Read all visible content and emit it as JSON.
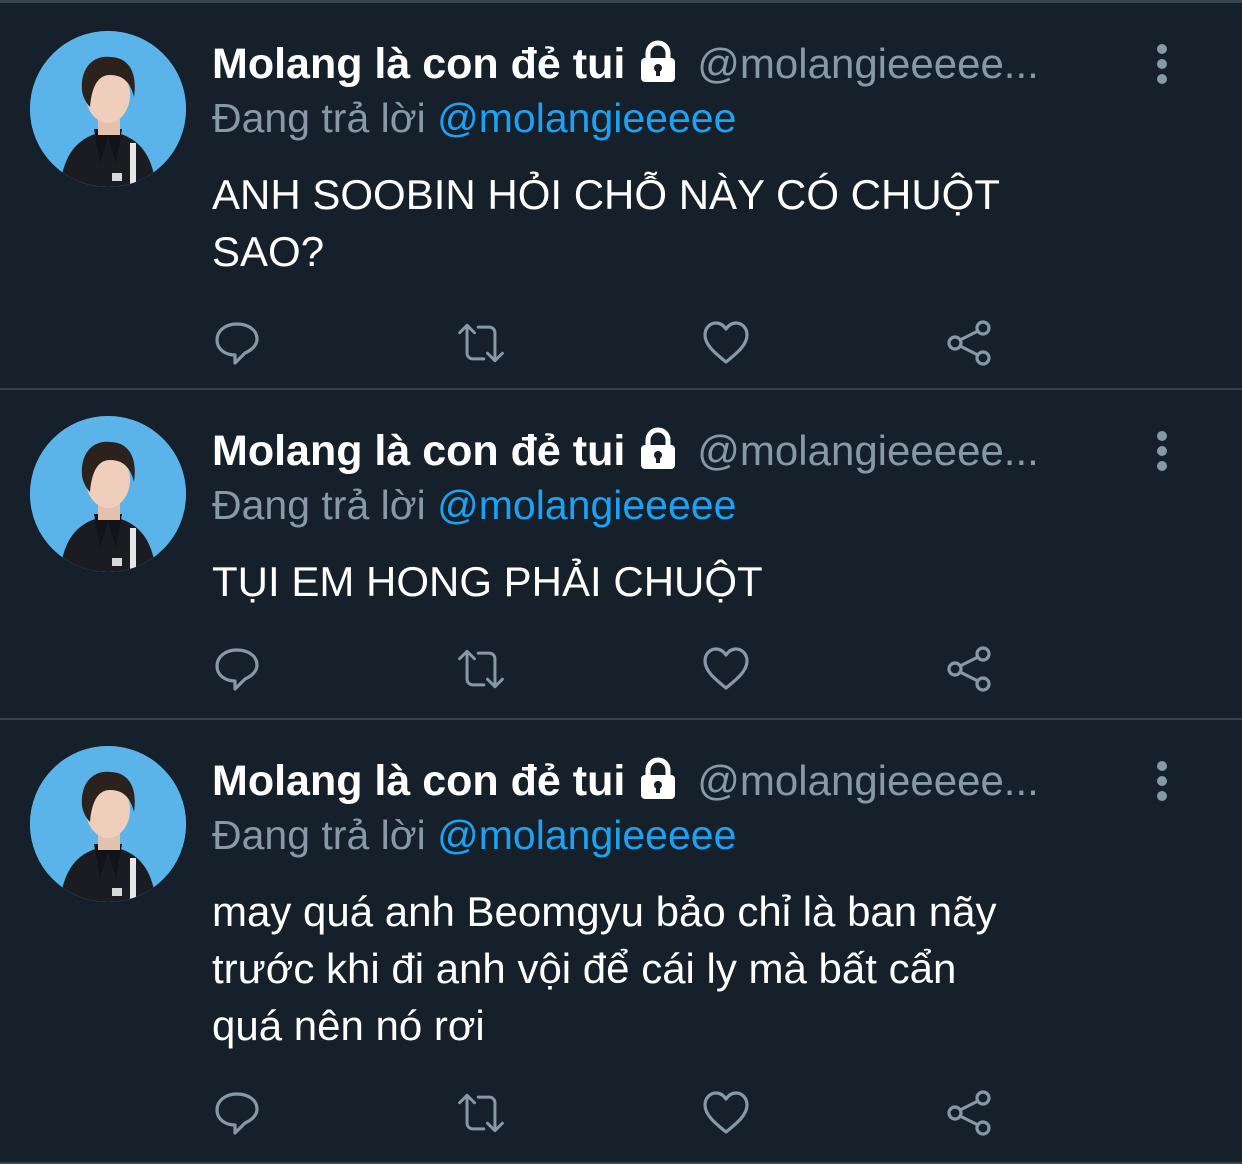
{
  "colors": {
    "background": "#15202b",
    "divider": "#38444d",
    "muted": "#8899a6",
    "accent": "#1da1f2",
    "avatar_bg": "#5ab4ea"
  },
  "tweets": [
    {
      "name": "Molang là con đẻ tui",
      "handle": "@molangieeeee...",
      "reply_prefix": "Đang trả lời",
      "reply_to": "@molangieeeee",
      "text_lines": [
        "ANH SOOBIN HỎI CHỖ NÀY CÓ CHUỘT",
        "SAO?"
      ],
      "icons": [
        "lock-icon",
        "more-icon",
        "reply-icon",
        "retweet-icon",
        "like-icon",
        "share-icon"
      ]
    },
    {
      "name": "Molang là con đẻ tui",
      "handle": "@molangieeeee...",
      "reply_prefix": "Đang trả lời",
      "reply_to": "@molangieeeee",
      "text_lines": [
        "TỤI EM HONG PHẢI CHUỘT"
      ],
      "icons": [
        "lock-icon",
        "more-icon",
        "reply-icon",
        "retweet-icon",
        "like-icon",
        "share-icon"
      ]
    },
    {
      "name": "Molang là con đẻ tui",
      "handle": "@molangieeeee...",
      "reply_prefix": "Đang trả lời",
      "reply_to": "@molangieeeee",
      "text_lines": [
        "may quá anh Beomgyu bảo chỉ là ban nãy",
        "trước khi đi anh vội để cái ly mà bất cẩn",
        "quá nên nó rơi"
      ],
      "icons": [
        "lock-icon",
        "more-icon",
        "reply-icon",
        "retweet-icon",
        "like-icon",
        "share-icon"
      ]
    }
  ]
}
